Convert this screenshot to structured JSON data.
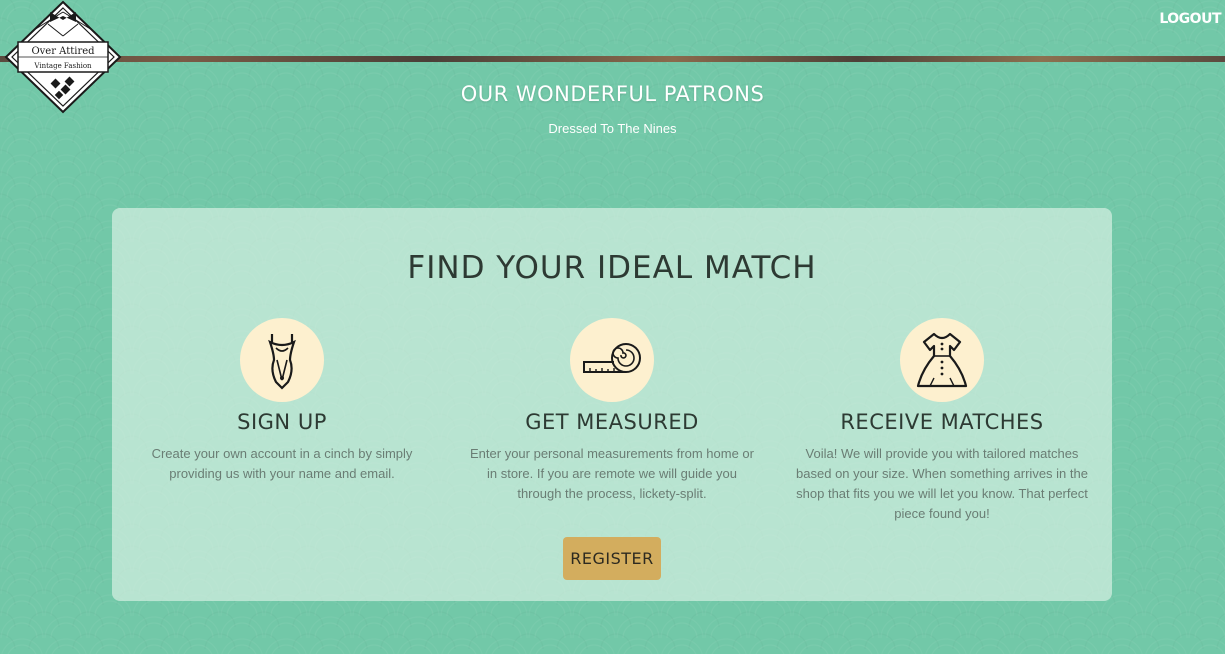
{
  "header": {
    "logo": {
      "line1": "Over Attired",
      "line2": "Vintage Fashion"
    },
    "logout_label": "LOGOUT"
  },
  "hero": {
    "title": "OUR WONDERFUL PATRONS",
    "subtitle": "Dressed To The Nines"
  },
  "card": {
    "title": "FIND YOUR IDEAL MATCH",
    "steps": [
      {
        "icon": "dress-form-icon",
        "title": "SIGN UP",
        "text": "Create your own account in a cinch by simply providing us with your name and email."
      },
      {
        "icon": "measuring-tape-icon",
        "title": "GET MEASURED",
        "text": "Enter your personal measurements from home or in store. If you are remote we will guide you through the process, lickety-split."
      },
      {
        "icon": "dress-icon",
        "title": "RECEIVE MATCHES",
        "text": "Voila! We will provide you with tailored matches based on your size. When something arrives in the shop that fits you we will let you know. That perfect piece found you!"
      }
    ],
    "register_label": "REGISTER"
  },
  "colors": {
    "background": "#72c8a8",
    "card": "#d3eedf",
    "icon_circle": "#fdf0cf",
    "button": "#d3ad5e",
    "heading": "#2d3a33",
    "body_text": "#6a7d74"
  }
}
